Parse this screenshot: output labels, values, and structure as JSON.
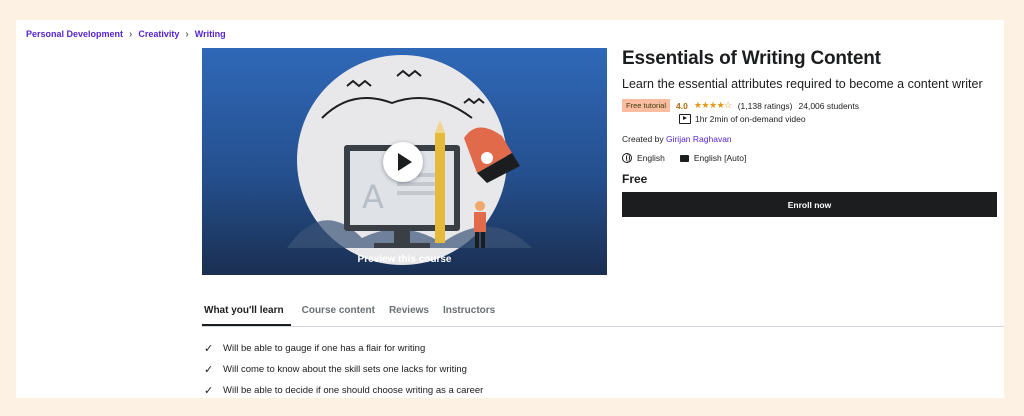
{
  "breadcrumb": [
    "Personal Development",
    "Creativity",
    "Writing"
  ],
  "preview": {
    "label": "Preview this course"
  },
  "course": {
    "title": "Essentials of Writing Content",
    "subtitle": "Learn the essential attributes required to become a content writer",
    "badge": "Free tutorial",
    "rating": "4.0",
    "stars": "★★★★☆",
    "ratings_count": "(1,138 ratings)",
    "students": "24,006 students",
    "video_length": "1hr 2min of on-demand video",
    "created_by_label": "Created by",
    "instructor": "Girijan Raghavan",
    "language": "English",
    "captions": "English [Auto]",
    "price": "Free",
    "enroll_label": "Enroll now"
  },
  "tabs": [
    {
      "label": "What you'll learn",
      "active": true
    },
    {
      "label": "Course content",
      "active": false
    },
    {
      "label": "Reviews",
      "active": false
    },
    {
      "label": "Instructors",
      "active": false
    }
  ],
  "learn": [
    "Will be able to gauge if one has a flair for writing",
    "Will come to know about the skill sets one lacks for writing",
    "Will be able to decide if one should choose writing as a career"
  ],
  "colors": {
    "background": "#fdf1e3",
    "link": "#5624d0",
    "badge": "#fcbca0",
    "rating": "#b4690e",
    "button": "#1c1d1f"
  }
}
